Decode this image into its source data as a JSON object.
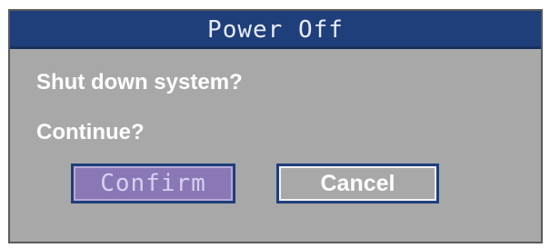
{
  "dialog": {
    "title": "Power Off",
    "message_line_1": "Shut down system?",
    "message_line_2": "Continue?",
    "buttons": {
      "confirm_label": "Confirm",
      "cancel_label": "Cancel"
    }
  },
  "colors": {
    "titlebar": "#1f3f7a",
    "dialog_background": "#a8a8a8",
    "confirm_selected": "#8a78b6",
    "text": "#ffffff"
  }
}
